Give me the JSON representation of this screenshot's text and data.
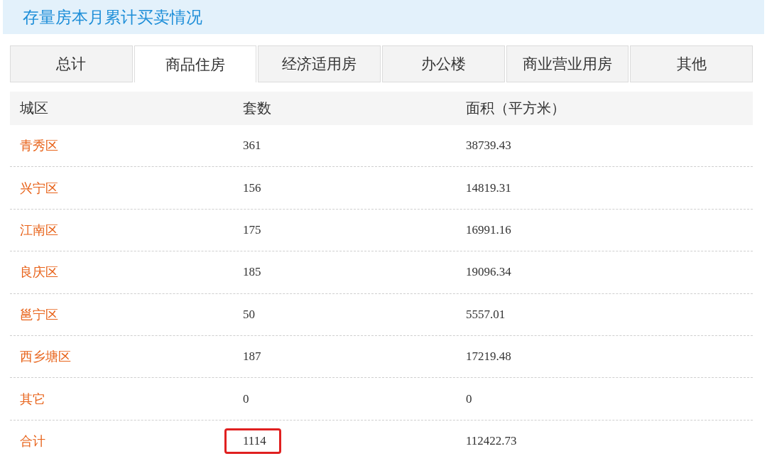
{
  "title": "存量房本月累计买卖情况",
  "tabs": [
    {
      "label": "总计",
      "selected": false
    },
    {
      "label": "商品住房",
      "selected": true
    },
    {
      "label": "经济适用房",
      "selected": false
    },
    {
      "label": "办公楼",
      "selected": false
    },
    {
      "label": "商业营业用房",
      "selected": false
    },
    {
      "label": "其他",
      "selected": false
    }
  ],
  "table": {
    "columns": [
      "城区",
      "套数",
      "面积（平方米）"
    ],
    "rows": [
      {
        "district": "青秀区",
        "units": "361",
        "area": "38739.43",
        "units_highlighted": false
      },
      {
        "district": "兴宁区",
        "units": "156",
        "area": "14819.31",
        "units_highlighted": false
      },
      {
        "district": "江南区",
        "units": "175",
        "area": "16991.16",
        "units_highlighted": false
      },
      {
        "district": "良庆区",
        "units": "185",
        "area": "19096.34",
        "units_highlighted": false
      },
      {
        "district": "邕宁区",
        "units": "50",
        "area": "5557.01",
        "units_highlighted": false
      },
      {
        "district": "西乡塘区",
        "units": "187",
        "area": "17219.48",
        "units_highlighted": false
      },
      {
        "district": "其它",
        "units": "0",
        "area": "0",
        "units_highlighted": false
      },
      {
        "district": "合计",
        "units": "1114",
        "area": "112422.73",
        "units_highlighted": true
      }
    ]
  }
}
